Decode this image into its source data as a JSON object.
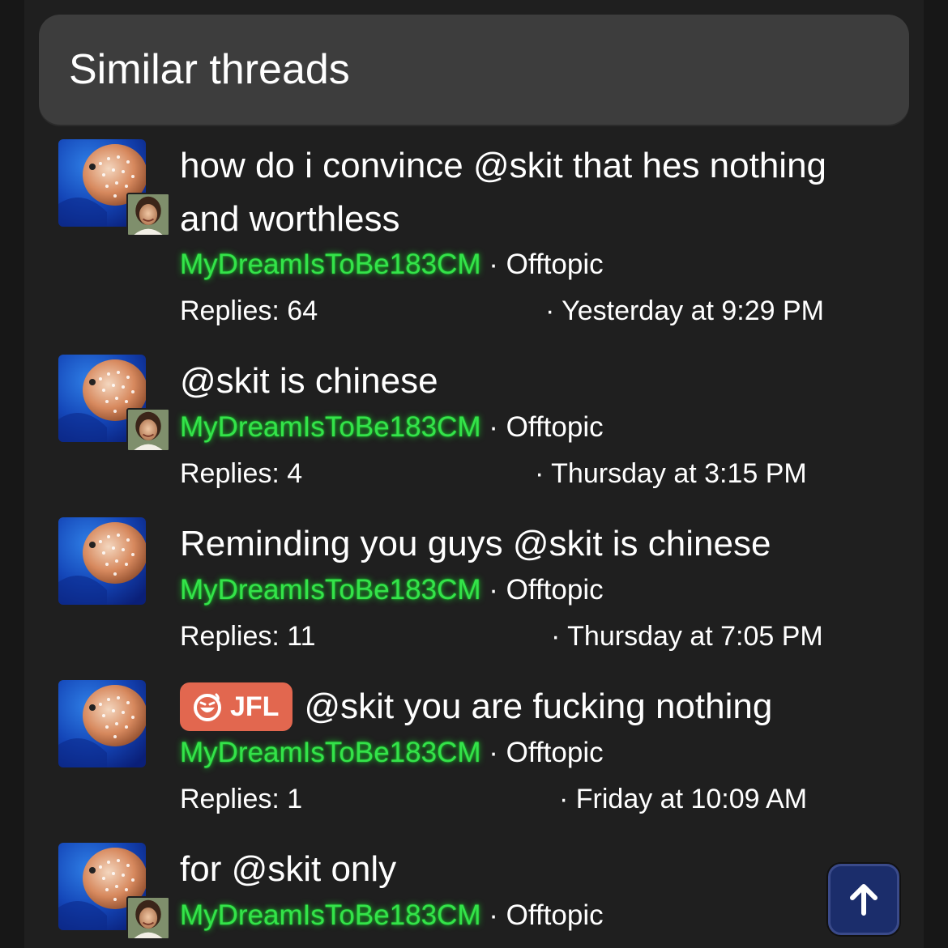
{
  "header": {
    "title": "Similar threads"
  },
  "threads": [
    {
      "title": "how do i convince @skit that hes nothing and worthless",
      "author": "MyDreamIsToBe183CM",
      "separator": "·",
      "forum": "Offtopic",
      "replies": "Replies: 64",
      "date": "· Yesterday at 9:29 PM",
      "has_mini_avatar": true,
      "prefix": ""
    },
    {
      "title": "@skit is chinese",
      "author": "MyDreamIsToBe183CM",
      "separator": "·",
      "forum": "Offtopic",
      "replies": "Replies: 4",
      "date": "· Thursday at 3:15 PM",
      "has_mini_avatar": true,
      "prefix": ""
    },
    {
      "title": "Reminding you guys @skit is chinese",
      "author": "MyDreamIsToBe183CM",
      "separator": "·",
      "forum": "Offtopic",
      "replies": "Replies: 11",
      "date": "· Thursday at 7:05 PM",
      "has_mini_avatar": false,
      "prefix": ""
    },
    {
      "title": "@skit you are fucking nothing",
      "author": "MyDreamIsToBe183CM",
      "separator": "·",
      "forum": "Offtopic",
      "replies": "Replies: 1",
      "date": "· Friday at 10:09 AM",
      "has_mini_avatar": false,
      "prefix": "JFL"
    },
    {
      "title": "for @skit only",
      "author": "MyDreamIsToBe183CM",
      "separator": "·",
      "forum": "Offtopic",
      "has_mini_avatar": true,
      "prefix": ""
    }
  ],
  "icons": {
    "avatar": "pufferfish-avatar-icon",
    "mini_avatar": "user-photo-icon",
    "prefix_icon": "laughing-face-icon",
    "scroll_top": "arrow-up-icon"
  },
  "colors": {
    "author": "#34e34a",
    "prefix_background": "#e2674f",
    "scroll_button": "#1b2d6b",
    "header_background": "#3d3d3d"
  }
}
